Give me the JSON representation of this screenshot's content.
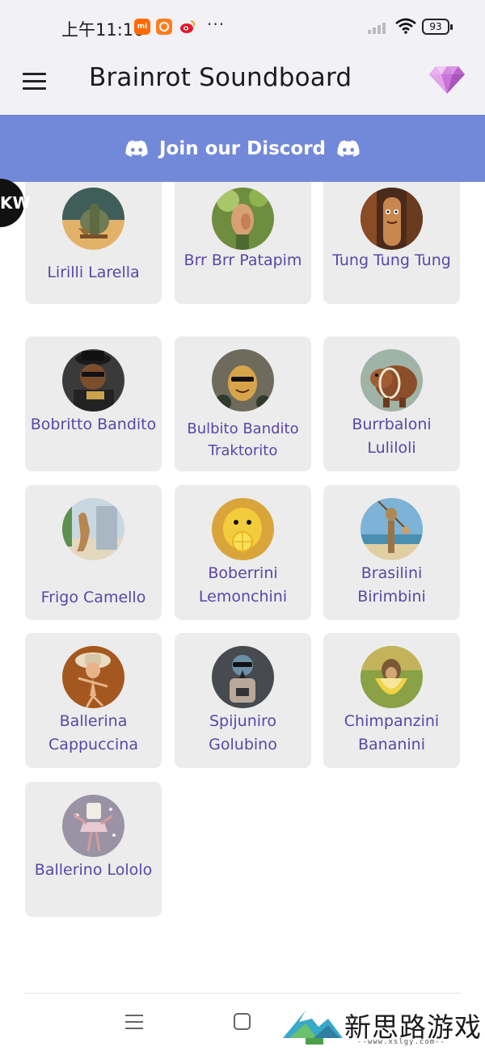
{
  "status_bar": {
    "time": "上午11:16",
    "notification_icons": [
      "mi-app-icon",
      "app-icon",
      "weibo-icon"
    ],
    "more": "···",
    "battery": "93"
  },
  "app_bar": {
    "title": "Brainrot Soundboard",
    "menu_icon": "hamburger-menu-icon",
    "premium_icon": "diamond-icon",
    "gem_color": "#c77bd6"
  },
  "discord": {
    "label": "Join our Discord",
    "color": "#7289da"
  },
  "badge": {
    "label": "KW"
  },
  "sounds": [
    {
      "name": "Lirilli Larella"
    },
    {
      "name": "Brr Brr Patapim"
    },
    {
      "name": "Tung Tung Tung"
    },
    {
      "name": "Bobritto Bandito"
    },
    {
      "name": "Bulbito Bandito Traktorito"
    },
    {
      "name": "Burrbaloni Luliloli"
    },
    {
      "name": "Frigo Camello"
    },
    {
      "name": "Boberrini Lemonchini"
    },
    {
      "name": "Brasilini Birimbini"
    },
    {
      "name": "Ballerina Cappuccina"
    },
    {
      "name": "Spijuniro Golubino"
    },
    {
      "name": "Chimpanzini Bananini"
    },
    {
      "name": "Ballerino Lololo"
    }
  ],
  "colors": {
    "label": "#5a46a6",
    "tile": "#ececec",
    "app_bar": "#f2f1f6"
  },
  "watermark": {
    "text": "新思路游戏",
    "url": "--www.xslgy.com--"
  }
}
